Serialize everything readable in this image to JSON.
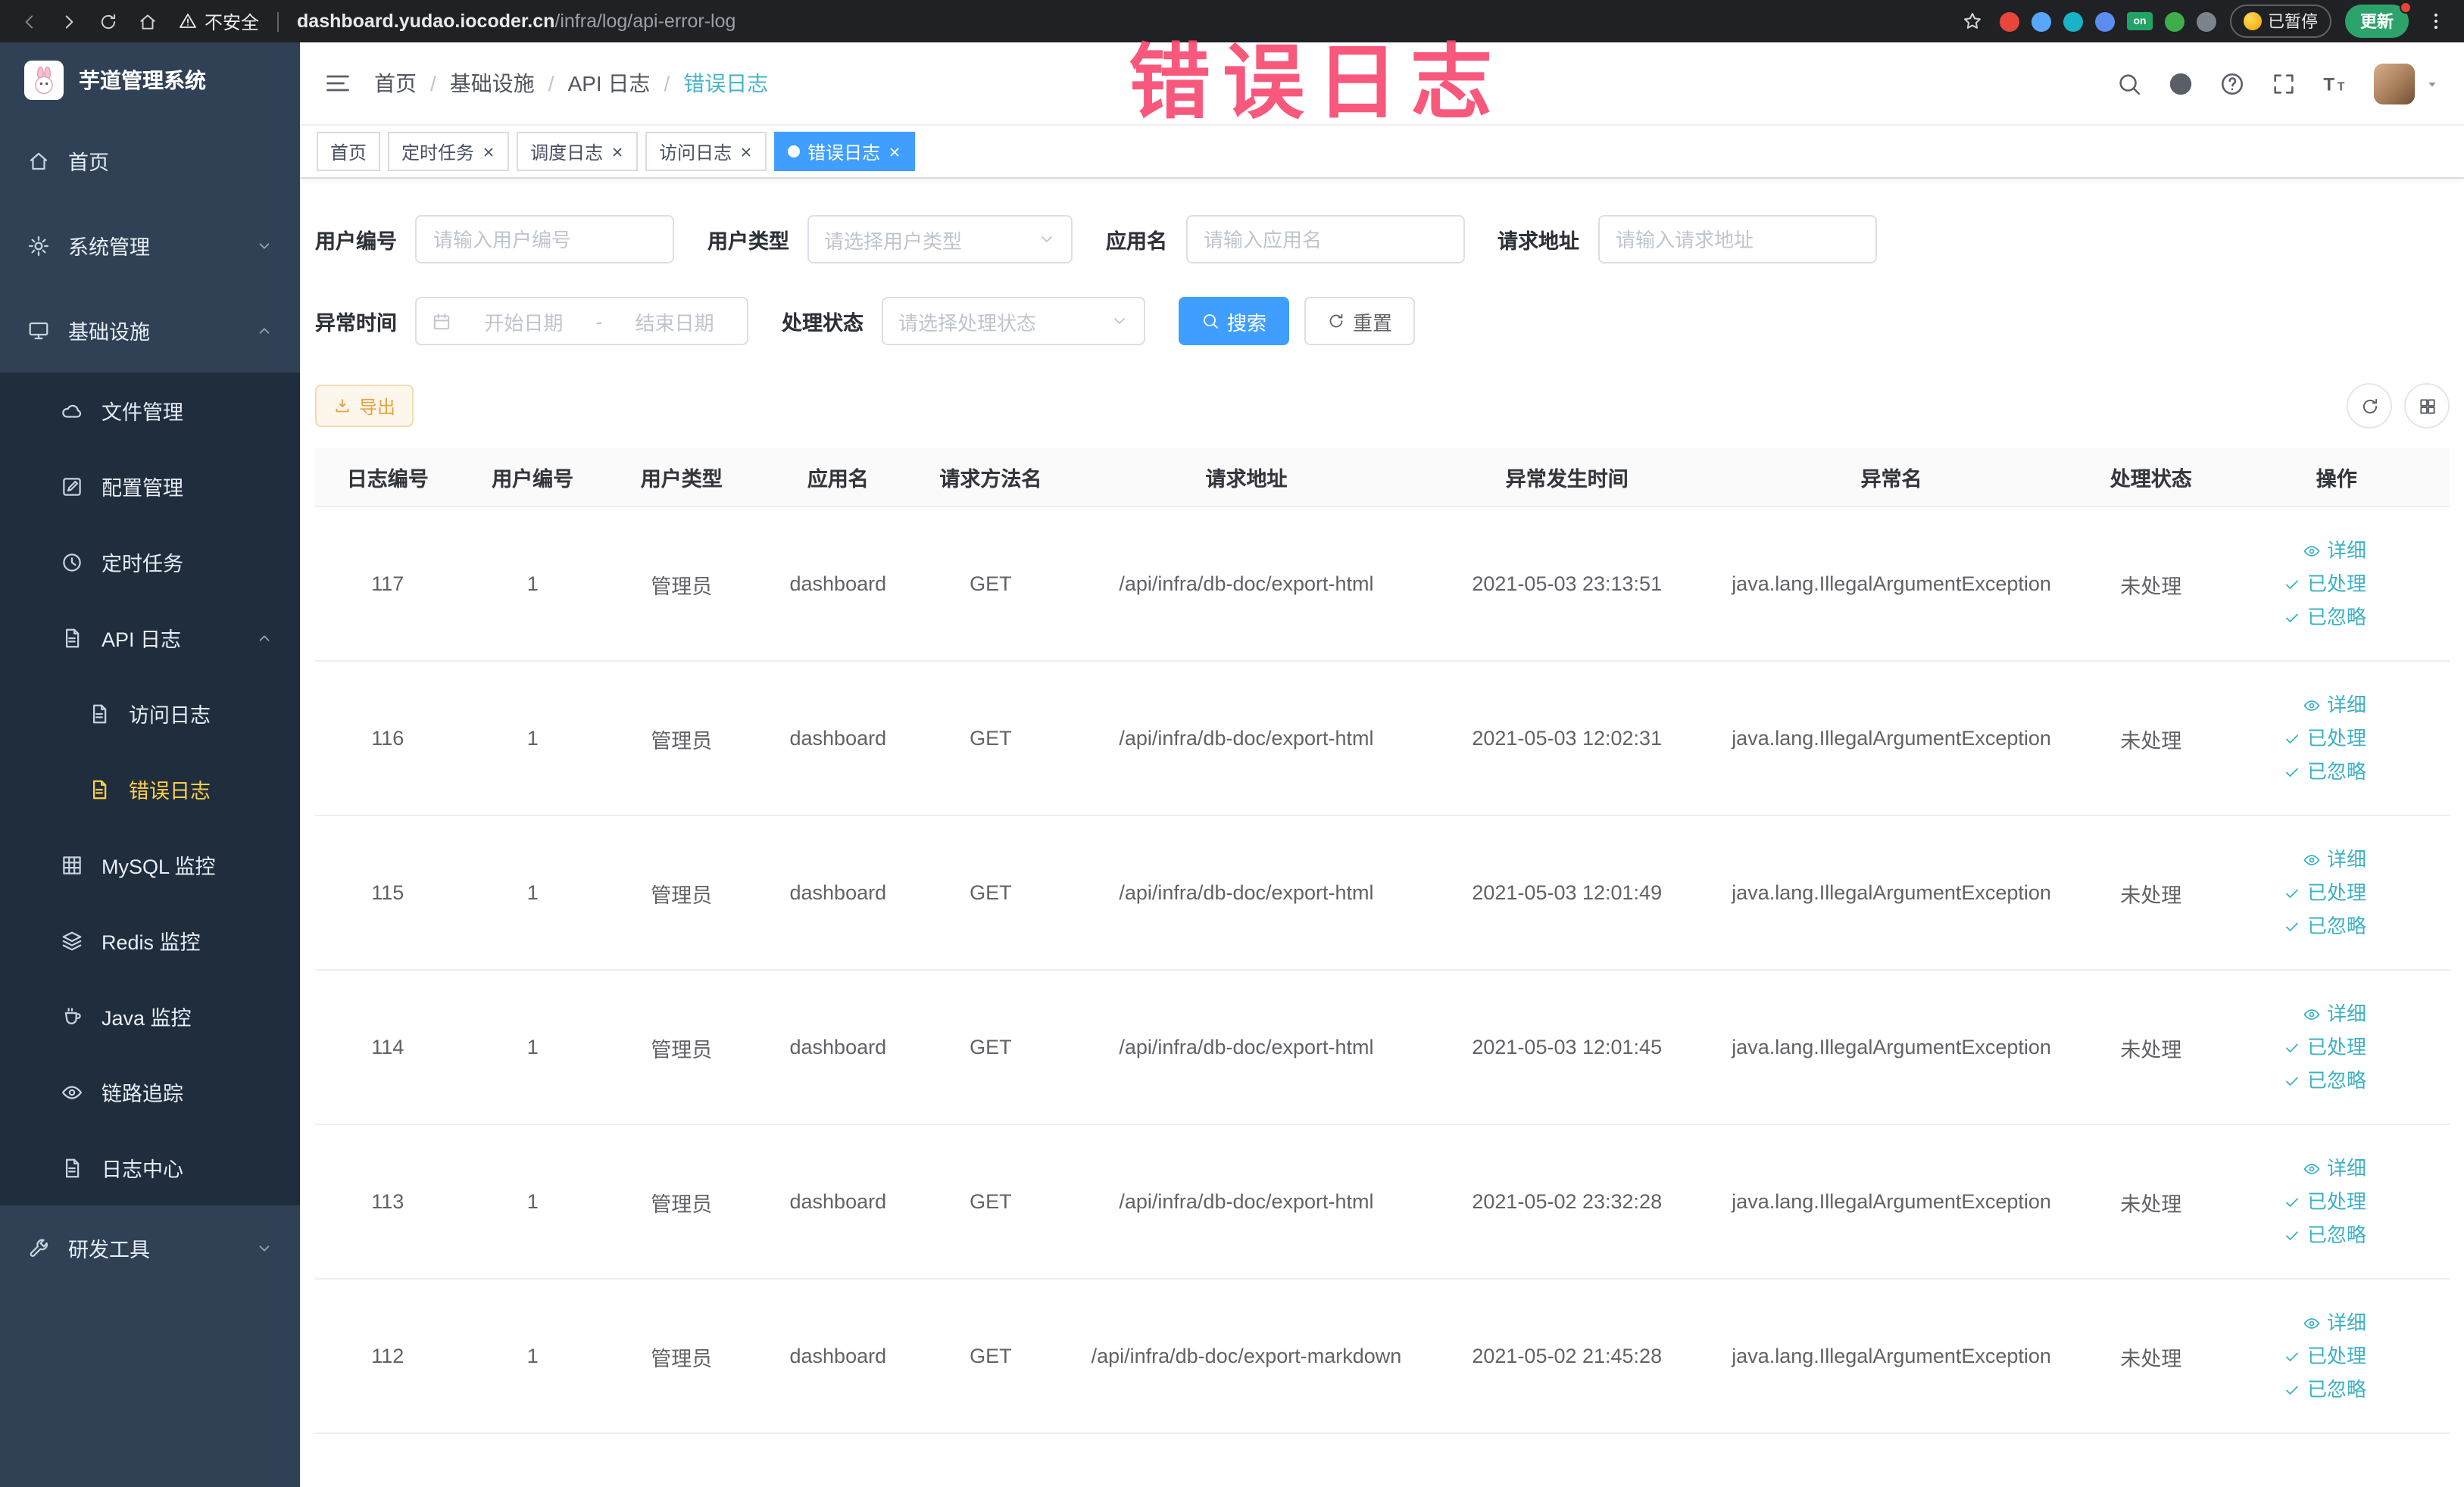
{
  "browser": {
    "security_warning": "不安全",
    "url": {
      "domain": "dashboard.yudao.iocoder.cn",
      "path": "/infra/log/api-error-log"
    },
    "extensions": [
      {
        "name": "extension-red-circle",
        "color": "#e8453c"
      },
      {
        "name": "extension-blue-drop",
        "color": "#58a6ff"
      },
      {
        "name": "extension-teal-circle",
        "color": "#18b3c7"
      },
      {
        "name": "extension-blue-puzzle",
        "color": "#5b8def"
      },
      {
        "name": "extension-on-badge",
        "color": "#21a366",
        "label": "on"
      },
      {
        "name": "extension-green-leaf",
        "color": "#3fae4a"
      },
      {
        "name": "extension-gray-puzzle",
        "color": "#7c838c"
      }
    ],
    "paused_badge": "已暂停",
    "update_button": "更新"
  },
  "overlay": {
    "text": "错误日志",
    "color": "#f8466d"
  },
  "sidebar": {
    "app_title": "芋道管理系统",
    "items": [
      {
        "key": "home",
        "label": "首页",
        "icon": "home-icon",
        "depth": 0
      },
      {
        "key": "system-management",
        "label": "系统管理",
        "icon": "gear-icon",
        "depth": 0,
        "expandable": true,
        "expanded": false
      },
      {
        "key": "infrastructure",
        "label": "基础设施",
        "icon": "monitor-icon",
        "depth": 0,
        "expandable": true,
        "expanded": true
      },
      {
        "key": "file-management",
        "label": "文件管理",
        "icon": "cloud-icon",
        "depth": 1
      },
      {
        "key": "config-management",
        "label": "配置管理",
        "icon": "edit-square-icon",
        "depth": 1
      },
      {
        "key": "scheduled-jobs",
        "label": "定时任务",
        "icon": "clock-icon",
        "depth": 1
      },
      {
        "key": "api-log",
        "label": "API 日志",
        "icon": "document-icon",
        "depth": 1,
        "expandable": true,
        "expanded": true
      },
      {
        "key": "access-log",
        "label": "访问日志",
        "icon": "document-icon",
        "depth": 2
      },
      {
        "key": "error-log",
        "label": "错误日志",
        "icon": "document-icon",
        "depth": 2,
        "active": true
      },
      {
        "key": "mysql-monitor",
        "label": "MySQL 监控",
        "icon": "grid-table-icon",
        "depth": 1
      },
      {
        "key": "redis-monitor",
        "label": "Redis 监控",
        "icon": "layers-icon",
        "depth": 1
      },
      {
        "key": "java-monitor",
        "label": "Java 监控",
        "icon": "coffee-icon",
        "depth": 1
      },
      {
        "key": "link-tracing",
        "label": "链路追踪",
        "icon": "eye-icon",
        "depth": 1
      },
      {
        "key": "log-center",
        "label": "日志中心",
        "icon": "document-icon",
        "depth": 1
      },
      {
        "key": "dev-tools",
        "label": "研发工具",
        "icon": "wrench-icon",
        "depth": 0,
        "expandable": true,
        "expanded": false
      }
    ]
  },
  "header": {
    "breadcrumb": [
      "首页",
      "基础设施",
      "API 日志",
      "错误日志"
    ],
    "breadcrumb_separator": "/"
  },
  "tabs": [
    {
      "key": "home",
      "label": "首页",
      "closable": false,
      "active": false
    },
    {
      "key": "scheduled-jobs",
      "label": "定时任务",
      "closable": true,
      "active": false
    },
    {
      "key": "job-log",
      "label": "调度日志",
      "closable": true,
      "active": false
    },
    {
      "key": "access-log",
      "label": "访问日志",
      "closable": true,
      "active": false
    },
    {
      "key": "error-log",
      "label": "错误日志",
      "closable": true,
      "active": true
    }
  ],
  "filters": {
    "user_id_label": "用户编号",
    "user_id_placeholder": "请输入用户编号",
    "user_type_label": "用户类型",
    "user_type_placeholder": "请选择用户类型",
    "app_name_label": "应用名",
    "app_name_placeholder": "请输入应用名",
    "request_url_label": "请求地址",
    "request_url_placeholder": "请输入请求地址",
    "exception_time_label": "异常时间",
    "start_date_placeholder": "开始日期",
    "end_date_placeholder": "结束日期",
    "date_separator": "-",
    "process_status_label": "处理状态",
    "process_status_placeholder": "请选择处理状态",
    "search_button": "搜索",
    "reset_button": "重置"
  },
  "toolbar": {
    "export_button": "导出"
  },
  "table": {
    "headers": [
      "日志编号",
      "用户编号",
      "用户类型",
      "应用名",
      "请求方法名",
      "请求地址",
      "异常发生时间",
      "异常名",
      "处理状态",
      "操作"
    ],
    "actions": {
      "detail": "详细",
      "processed": "已处理",
      "ignored": "已忽略"
    },
    "rows": [
      {
        "id": "117",
        "user_id": "1",
        "user_type": "管理员",
        "app": "dashboard",
        "method": "GET",
        "url": "/api/infra/db-doc/export-html",
        "time": "2021-05-03 23:13:51",
        "exception": "java.lang.IllegalArgumentException",
        "status": "未处理"
      },
      {
        "id": "116",
        "user_id": "1",
        "user_type": "管理员",
        "app": "dashboard",
        "method": "GET",
        "url": "/api/infra/db-doc/export-html",
        "time": "2021-05-03 12:02:31",
        "exception": "java.lang.IllegalArgumentException",
        "status": "未处理"
      },
      {
        "id": "115",
        "user_id": "1",
        "user_type": "管理员",
        "app": "dashboard",
        "method": "GET",
        "url": "/api/infra/db-doc/export-html",
        "time": "2021-05-03 12:01:49",
        "exception": "java.lang.IllegalArgumentException",
        "status": "未处理"
      },
      {
        "id": "114",
        "user_id": "1",
        "user_type": "管理员",
        "app": "dashboard",
        "method": "GET",
        "url": "/api/infra/db-doc/export-html",
        "time": "2021-05-03 12:01:45",
        "exception": "java.lang.IllegalArgumentException",
        "status": "未处理"
      },
      {
        "id": "113",
        "user_id": "1",
        "user_type": "管理员",
        "app": "dashboard",
        "method": "GET",
        "url": "/api/infra/db-doc/export-html",
        "time": "2021-05-02 23:32:28",
        "exception": "java.lang.IllegalArgumentException",
        "status": "未处理"
      },
      {
        "id": "112",
        "user_id": "1",
        "user_type": "管理员",
        "app": "dashboard",
        "method": "GET",
        "url": "/api/infra/db-doc/export-markdown",
        "time": "2021-05-02 21:45:28",
        "exception": "java.lang.IllegalArgumentException",
        "status": "未处理"
      }
    ]
  },
  "colors": {
    "primary": "#409eff",
    "warning": "#e6a23c",
    "link_teal": "#3cb1c3",
    "sidebar_bg": "#304156",
    "submenu_bg": "#1f2d3d",
    "active_menu_text": "#ffd04b"
  }
}
